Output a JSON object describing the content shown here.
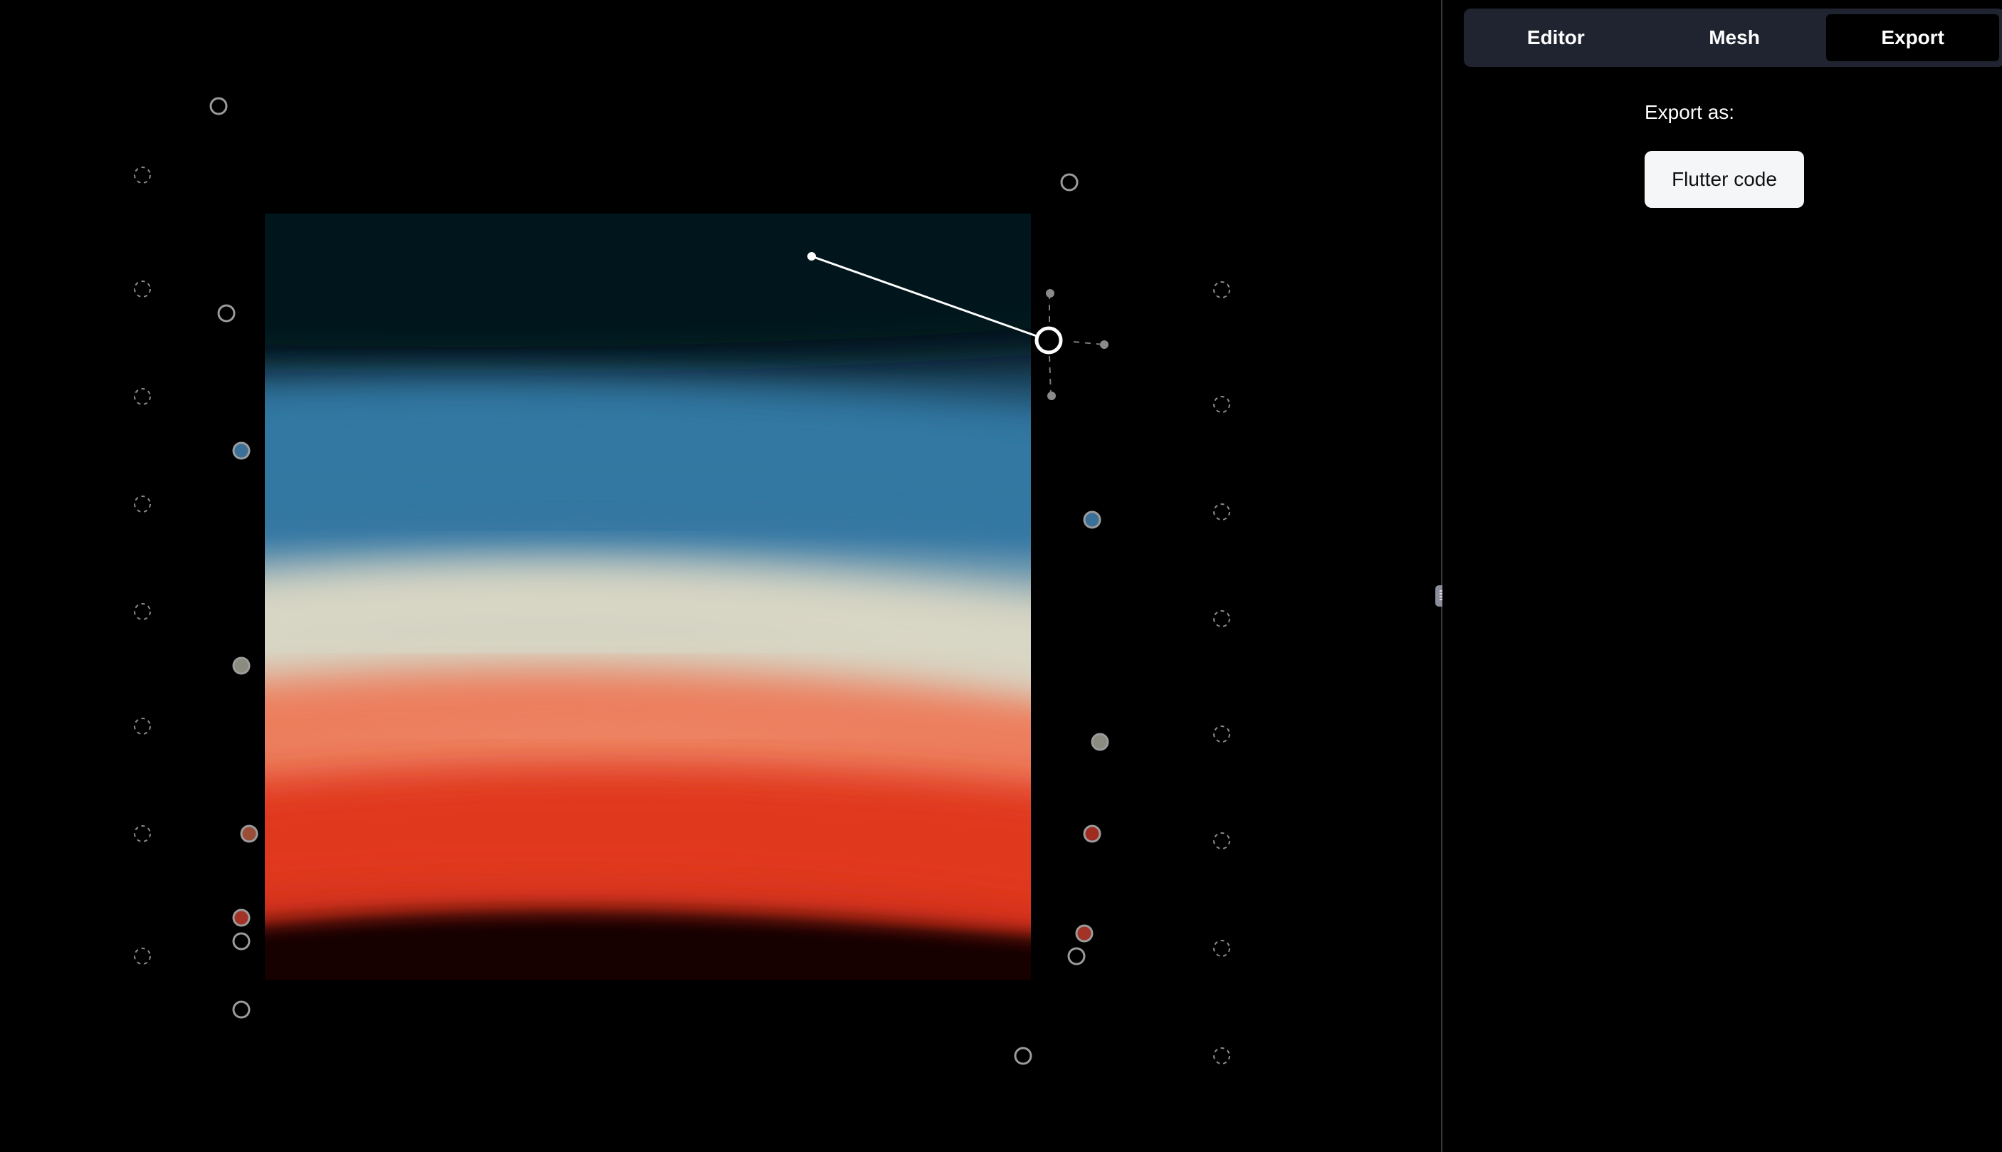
{
  "tabs": [
    {
      "label": "Editor",
      "active": false
    },
    {
      "label": "Mesh",
      "active": false
    },
    {
      "label": "Export",
      "active": true
    }
  ],
  "export_panel": {
    "heading": "Export as:",
    "button_label": "Flutter code"
  },
  "gradient_colors": {
    "top_dark": "#05161b",
    "blue": "#3a7ba6",
    "cream": "#d6d4c2",
    "salmon": "#ee8767",
    "red": "#e3412a",
    "deep_red": "#d5301c",
    "bottom_dark": "#150101"
  },
  "control_points": {
    "left_vertices": [
      {
        "color": "#000000"
      },
      {
        "color": "#000000"
      },
      {
        "color": "#3a6f97"
      },
      {
        "color": "#8b8b80"
      },
      {
        "color": "#9a4e38"
      },
      {
        "color": "#a23326"
      },
      {
        "color": "#000000"
      },
      {
        "color": "#000000"
      }
    ],
    "right_vertices": [
      {
        "color": "#000000"
      },
      {
        "color": "#000000"
      },
      {
        "color": "#3a6f97"
      },
      {
        "color": "#8b8b80"
      },
      {
        "color": "#a02b20"
      },
      {
        "color": "#a23326"
      },
      {
        "color": "#000000"
      },
      {
        "color": "#000000"
      }
    ],
    "selected_vertex": {
      "color": "#000000"
    }
  }
}
